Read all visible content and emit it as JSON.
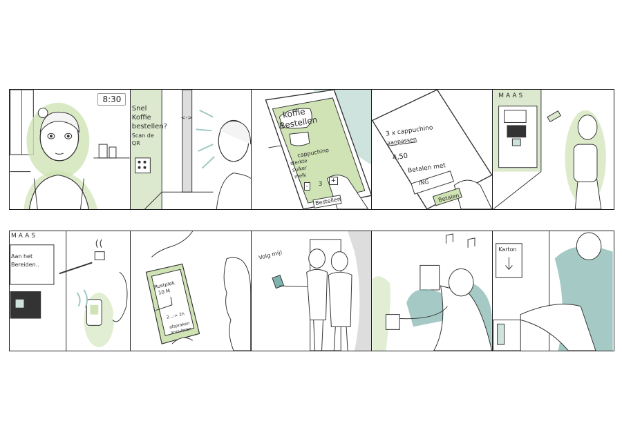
{
  "panels": {
    "p1": {
      "clock": "8:30"
    },
    "p2": {
      "poster_line1": "Snel",
      "poster_line2": "Koffie",
      "poster_line3": "bestellen?",
      "poster_line4": "Scan de",
      "poster_line5": "QR",
      "door_sign": "<->"
    },
    "p3": {
      "title_line1": "koffie",
      "title_line2": "Bestellen",
      "item": "cappuchino",
      "opt1": "sterkte",
      "opt2": "suiker",
      "opt3": "melk",
      "qty": "3",
      "minus": "-",
      "plus": "+",
      "button": "Bestellen"
    },
    "p4": {
      "line1": "3 x cappuchino",
      "line2": "aanpassen",
      "price": "4,50",
      "pay_label": "Betalen met",
      "bank": "ING",
      "button": "Betalen"
    },
    "p5": {
      "sign": "MAAS"
    },
    "p6": {
      "sign": "MAAS",
      "screen_line1": "Aan het",
      "screen_line2": "Bereiden.."
    },
    "p7": {
      "map_title_line1": "Rustplek",
      "map_title_line2": "10 M",
      "map_line": "2...-> 2h",
      "map_btn_line1": "afspraken",
      "map_btn_line2": "annuleren"
    },
    "p8": {
      "speech": "Volg mij!"
    },
    "p9": {},
    "p10": {
      "sign": "Karton"
    }
  }
}
